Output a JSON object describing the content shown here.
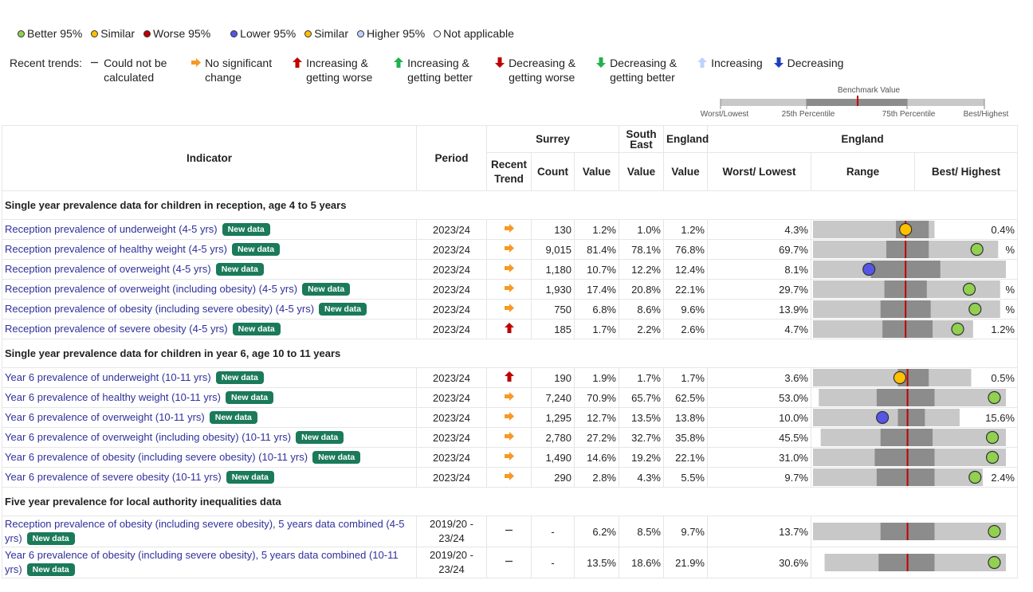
{
  "legend_compare": {
    "items": [
      {
        "label": "Better 95%",
        "color": "#92d050"
      },
      {
        "label": "Similar",
        "color": "#ffc000"
      },
      {
        "label": "Worse 95%",
        "color": "#c00000"
      }
    ],
    "items2": [
      {
        "label": "Lower 95%",
        "color": "#5555e6"
      },
      {
        "label": "Similar",
        "color": "#ffc000"
      },
      {
        "label": "Higher 95%",
        "color": "#bed2ff"
      }
    ],
    "na_label": "Not applicable"
  },
  "legend_trends": {
    "title": "Recent trends:",
    "items": [
      {
        "label": "Could not be calculated",
        "icon": "dash-icon"
      },
      {
        "label": "No significant change",
        "icon": "arrow-right-orange-icon"
      },
      {
        "label": "Increasing & getting worse",
        "icon": "arrow-up-red-icon"
      },
      {
        "label": "Increasing & getting better",
        "icon": "arrow-up-green-icon"
      },
      {
        "label": "Decreasing & getting worse",
        "icon": "arrow-down-red-icon"
      },
      {
        "label": "Decreasing & getting better",
        "icon": "arrow-down-green-icon"
      },
      {
        "label": "Increasing",
        "icon": "arrow-up-lightblue-icon"
      },
      {
        "label": "Decreasing",
        "icon": "arrow-down-blue-icon"
      }
    ]
  },
  "benchmark_key": {
    "title": "Benchmark Value",
    "labels": [
      "Worst/Lowest",
      "25th Percentile",
      "75th Percentile",
      "Best/Highest"
    ]
  },
  "header": {
    "indicator": "Indicator",
    "period": "Period",
    "surrey": "Surrey",
    "south_east": "South East",
    "england": "England",
    "england_group": "England",
    "recent_trend": "Recent Trend",
    "count": "Count",
    "value": "Value",
    "se_value": "Value",
    "eng_value": "Value",
    "worst": "Worst/ Lowest",
    "range": "Range",
    "best": "Best/ Highest"
  },
  "badge_label": "New data",
  "sections": [
    {
      "title": "Single year prevalence data for children in reception, age 4 to 5 years",
      "rows": [
        {
          "indicator": "Reception prevalence of underweight (4-5 yrs)",
          "period": "2023/24",
          "trend": "right",
          "count": "130",
          "value": "1.2%",
          "se": "1.0%",
          "eng": "1.2%",
          "worst": "4.3%",
          "best": "0.4%",
          "bar": {
            "worst": 0.0,
            "p25": 0.43,
            "p75": 0.6,
            "best": 0.61,
            "bench": 0.48,
            "marker": 0.48,
            "color": "#ffc000",
            "barEnd": 0.63
          }
        },
        {
          "indicator": "Reception prevalence of healthy weight (4-5 yrs)",
          "period": "2023/24",
          "trend": "right",
          "count": "9,015",
          "value": "81.4%",
          "se": "78.1%",
          "eng": "76.8%",
          "worst": "69.7%",
          "best": "%",
          "bar": {
            "worst": 0.0,
            "p25": 0.38,
            "p75": 0.6,
            "best": 0.96,
            "bench": 0.48,
            "marker": 0.85,
            "color": "#92d050",
            "barEnd": 0.96
          }
        },
        {
          "indicator": "Reception prevalence of overweight (4-5 yrs)",
          "period": "2023/24",
          "trend": "right",
          "count": "1,180",
          "value": "10.7%",
          "se": "12.2%",
          "eng": "12.4%",
          "worst": "8.1%",
          "best": "",
          "bar": {
            "worst": 0.0,
            "p25": 0.3,
            "p75": 0.66,
            "best": 1.0,
            "bench": 0.48,
            "marker": 0.29,
            "color": "#5555e6",
            "barEnd": 1.0
          }
        },
        {
          "indicator": "Reception prevalence of overweight (including obesity) (4-5 yrs)",
          "period": "2023/24",
          "trend": "right",
          "count": "1,930",
          "value": "17.4%",
          "se": "20.8%",
          "eng": "22.1%",
          "worst": "29.7%",
          "best": "%",
          "bar": {
            "worst": 0.0,
            "p25": 0.37,
            "p75": 0.59,
            "best": 0.97,
            "bench": 0.48,
            "marker": 0.81,
            "color": "#92d050",
            "barEnd": 0.97
          }
        },
        {
          "indicator": "Reception prevalence of obesity (including severe obesity) (4-5 yrs)",
          "period": "2023/24",
          "trend": "right",
          "count": "750",
          "value": "6.8%",
          "se": "8.6%",
          "eng": "9.6%",
          "worst": "13.9%",
          "best": "%",
          "bar": {
            "worst": 0.0,
            "p25": 0.35,
            "p75": 0.61,
            "best": 0.97,
            "bench": 0.48,
            "marker": 0.84,
            "color": "#92d050",
            "barEnd": 0.97
          }
        },
        {
          "indicator": "Reception prevalence of severe obesity (4-5 yrs)",
          "period": "2023/24",
          "trend": "up-red",
          "count": "185",
          "value": "1.7%",
          "se": "2.2%",
          "eng": "2.6%",
          "worst": "4.7%",
          "best": "1.2%",
          "bar": {
            "worst": 0.0,
            "p25": 0.36,
            "p75": 0.62,
            "best": 0.83,
            "bench": 0.48,
            "marker": 0.75,
            "color": "#92d050",
            "barEnd": 0.83
          }
        }
      ]
    },
    {
      "title": "Single year prevalence data for children in year 6, age 10 to 11 years",
      "rows": [
        {
          "indicator": "Year 6 prevalence of underweight (10-11 yrs)",
          "period": "2023/24",
          "trend": "up-red",
          "count": "190",
          "value": "1.9%",
          "se": "1.7%",
          "eng": "1.7%",
          "worst": "3.6%",
          "best": "0.5%",
          "bar": {
            "worst": 0.0,
            "p25": 0.44,
            "p75": 0.6,
            "best": 0.82,
            "bench": 0.49,
            "marker": 0.45,
            "color": "#ffc000",
            "barEnd": 0.82
          }
        },
        {
          "indicator": "Year 6 prevalence of healthy weight (10-11 yrs)",
          "period": "2023/24",
          "trend": "right",
          "count": "7,240",
          "value": "70.9%",
          "se": "65.7%",
          "eng": "62.5%",
          "worst": "53.0%",
          "best": "",
          "bar": {
            "worst": 0.03,
            "p25": 0.33,
            "p75": 0.63,
            "best": 1.0,
            "bench": 0.49,
            "marker": 0.94,
            "color": "#92d050",
            "barEnd": 1.0
          }
        },
        {
          "indicator": "Year 6 prevalence of overweight (10-11 yrs)",
          "period": "2023/24",
          "trend": "right",
          "count": "1,295",
          "value": "12.7%",
          "se": "13.5%",
          "eng": "13.8%",
          "worst": "10.0%",
          "best": "15.6%",
          "bar": {
            "worst": 0.0,
            "p25": 0.44,
            "p75": 0.58,
            "best": 0.76,
            "bench": 0.49,
            "marker": 0.36,
            "color": "#5555e6",
            "barEnd": 0.76
          }
        },
        {
          "indicator": "Year 6 prevalence of overweight (including obesity) (10-11 yrs)",
          "period": "2023/24",
          "trend": "right",
          "count": "2,780",
          "value": "27.2%",
          "se": "32.7%",
          "eng": "35.8%",
          "worst": "45.5%",
          "best": "",
          "bar": {
            "worst": 0.04,
            "p25": 0.35,
            "p75": 0.62,
            "best": 1.0,
            "bench": 0.49,
            "marker": 0.93,
            "color": "#92d050",
            "barEnd": 1.0
          }
        },
        {
          "indicator": "Year 6 prevalence of obesity (including severe obesity) (10-11 yrs)",
          "period": "2023/24",
          "trend": "right",
          "count": "1,490",
          "value": "14.6%",
          "se": "19.2%",
          "eng": "22.1%",
          "worst": "31.0%",
          "best": "",
          "bar": {
            "worst": 0.0,
            "p25": 0.32,
            "p75": 0.63,
            "best": 1.0,
            "bench": 0.49,
            "marker": 0.93,
            "color": "#92d050",
            "barEnd": 1.0
          }
        },
        {
          "indicator": "Year 6 prevalence of severe obesity (10-11 yrs)",
          "period": "2023/24",
          "trend": "right",
          "count": "290",
          "value": "2.8%",
          "se": "4.3%",
          "eng": "5.5%",
          "worst": "9.7%",
          "best": "2.4%",
          "bar": {
            "worst": 0.0,
            "p25": 0.33,
            "p75": 0.63,
            "best": 0.88,
            "bench": 0.49,
            "marker": 0.84,
            "color": "#92d050",
            "barEnd": 0.88
          }
        }
      ]
    },
    {
      "title": "Five year prevalence for local authority inequalities data",
      "rows": [
        {
          "indicator": "Reception prevalence of obesity (including severe obesity), 5 years data combined (4-5 yrs)",
          "period": "2019/20 - 23/24",
          "trend": "dash",
          "count": "-",
          "value": "6.2%",
          "se": "8.5%",
          "eng": "9.7%",
          "worst": "13.7%",
          "best": "",
          "wrap": true,
          "bar": {
            "worst": 0.0,
            "p25": 0.35,
            "p75": 0.63,
            "best": 1.0,
            "bench": 0.49,
            "marker": 0.94,
            "color": "#92d050",
            "barEnd": 1.0
          }
        },
        {
          "indicator": "Year 6 prevalence of obesity (including severe obesity), 5 years data combined (10-11 yrs)",
          "period": "2019/20 - 23/24",
          "trend": "dash",
          "count": "-",
          "value": "13.5%",
          "se": "18.6%",
          "eng": "21.9%",
          "worst": "30.6%",
          "best": "",
          "wrap": true,
          "bar": {
            "worst": 0.06,
            "p25": 0.34,
            "p75": 0.63,
            "best": 1.0,
            "bench": 0.49,
            "marker": 0.94,
            "color": "#92d050",
            "barEnd": 1.0
          }
        }
      ]
    }
  ]
}
